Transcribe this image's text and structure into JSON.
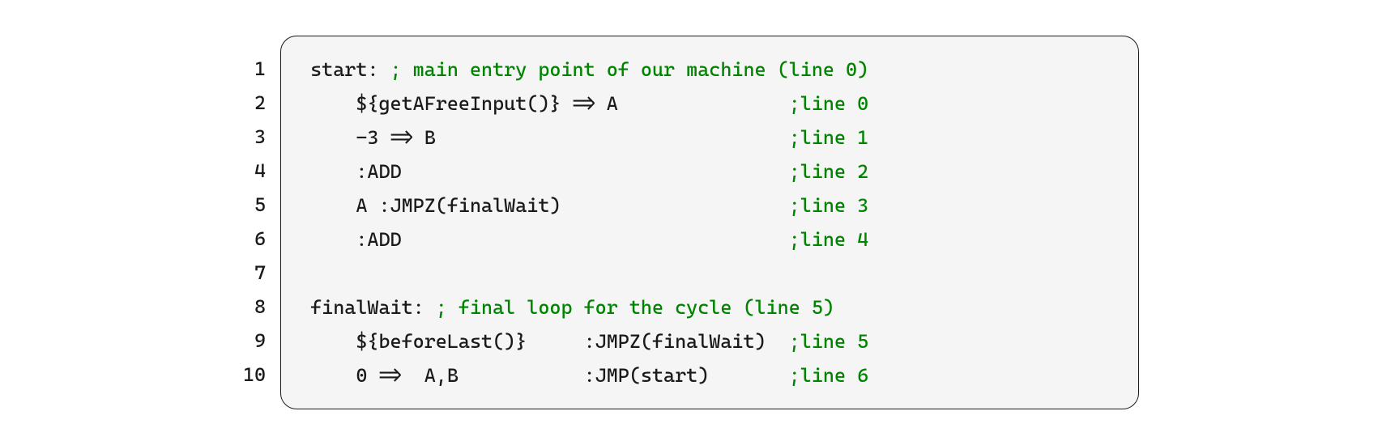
{
  "code": {
    "lines": [
      {
        "num": "1",
        "segments": [
          {
            "t": "start: ",
            "c": "plain"
          },
          {
            "t": "; main entry point of our machine (line 0)",
            "c": "comment"
          }
        ]
      },
      {
        "num": "2",
        "segments": [
          {
            "t": "    ${getAFreeInput()} => A               ",
            "c": "plain"
          },
          {
            "t": ";line 0",
            "c": "comment"
          }
        ]
      },
      {
        "num": "3",
        "segments": [
          {
            "t": "    -3 => B                               ",
            "c": "plain"
          },
          {
            "t": ";line 1",
            "c": "comment"
          }
        ]
      },
      {
        "num": "4",
        "segments": [
          {
            "t": "    :ADD                                  ",
            "c": "plain"
          },
          {
            "t": ";line 2",
            "c": "comment"
          }
        ]
      },
      {
        "num": "5",
        "segments": [
          {
            "t": "    A :JMPZ(finalWait)                    ",
            "c": "plain"
          },
          {
            "t": ";line 3",
            "c": "comment"
          }
        ]
      },
      {
        "num": "6",
        "segments": [
          {
            "t": "    :ADD                                  ",
            "c": "plain"
          },
          {
            "t": ";line 4",
            "c": "comment"
          }
        ]
      },
      {
        "num": "7",
        "segments": [
          {
            "t": "",
            "c": "plain"
          }
        ]
      },
      {
        "num": "8",
        "segments": [
          {
            "t": "finalWait: ",
            "c": "plain"
          },
          {
            "t": "; final loop for the cycle (line 5)",
            "c": "comment"
          }
        ]
      },
      {
        "num": "9",
        "segments": [
          {
            "t": "    ${beforeLast()}     :JMPZ(finalWait)  ",
            "c": "plain"
          },
          {
            "t": ";line 5",
            "c": "comment"
          }
        ]
      },
      {
        "num": "10",
        "segments": [
          {
            "t": "    0 =>  A,B           :JMP(start)       ",
            "c": "plain"
          },
          {
            "t": ";line 6",
            "c": "comment"
          }
        ]
      }
    ]
  }
}
